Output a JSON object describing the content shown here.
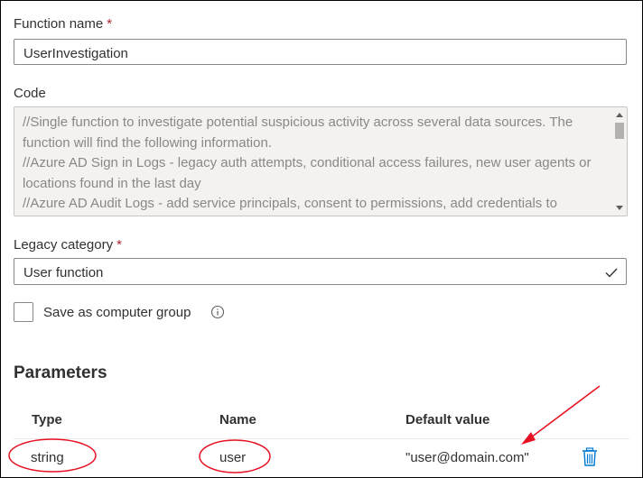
{
  "function_name": {
    "label": "Function name",
    "required_mark": "*",
    "value": "UserInvestigation"
  },
  "code": {
    "label": "Code",
    "text": "//Single function to investigate potential suspicious activity across several data sources. The function will find the following information.\n//Azure AD Sign in Logs - legacy auth attempts, conditional access failures, new user agents or locations found in the last day\n//Azure AD Audit Logs - add service principals, consent to permissions, add credentials to"
  },
  "legacy_category": {
    "label": "Legacy category",
    "required_mark": "*",
    "value": "User function"
  },
  "save_group": {
    "label": "Save as computer group",
    "checked": false
  },
  "parameters": {
    "title": "Parameters",
    "columns": [
      "Type",
      "Name",
      "Default value"
    ],
    "rows": [
      {
        "type": "string",
        "name": "user",
        "default_value": "\"user@domain.com\""
      }
    ]
  },
  "annotation_color": "#e81123",
  "icons": [
    "checkmark-icon",
    "info-icon",
    "delete-icon",
    "scroll-up-icon",
    "scroll-down-icon"
  ]
}
